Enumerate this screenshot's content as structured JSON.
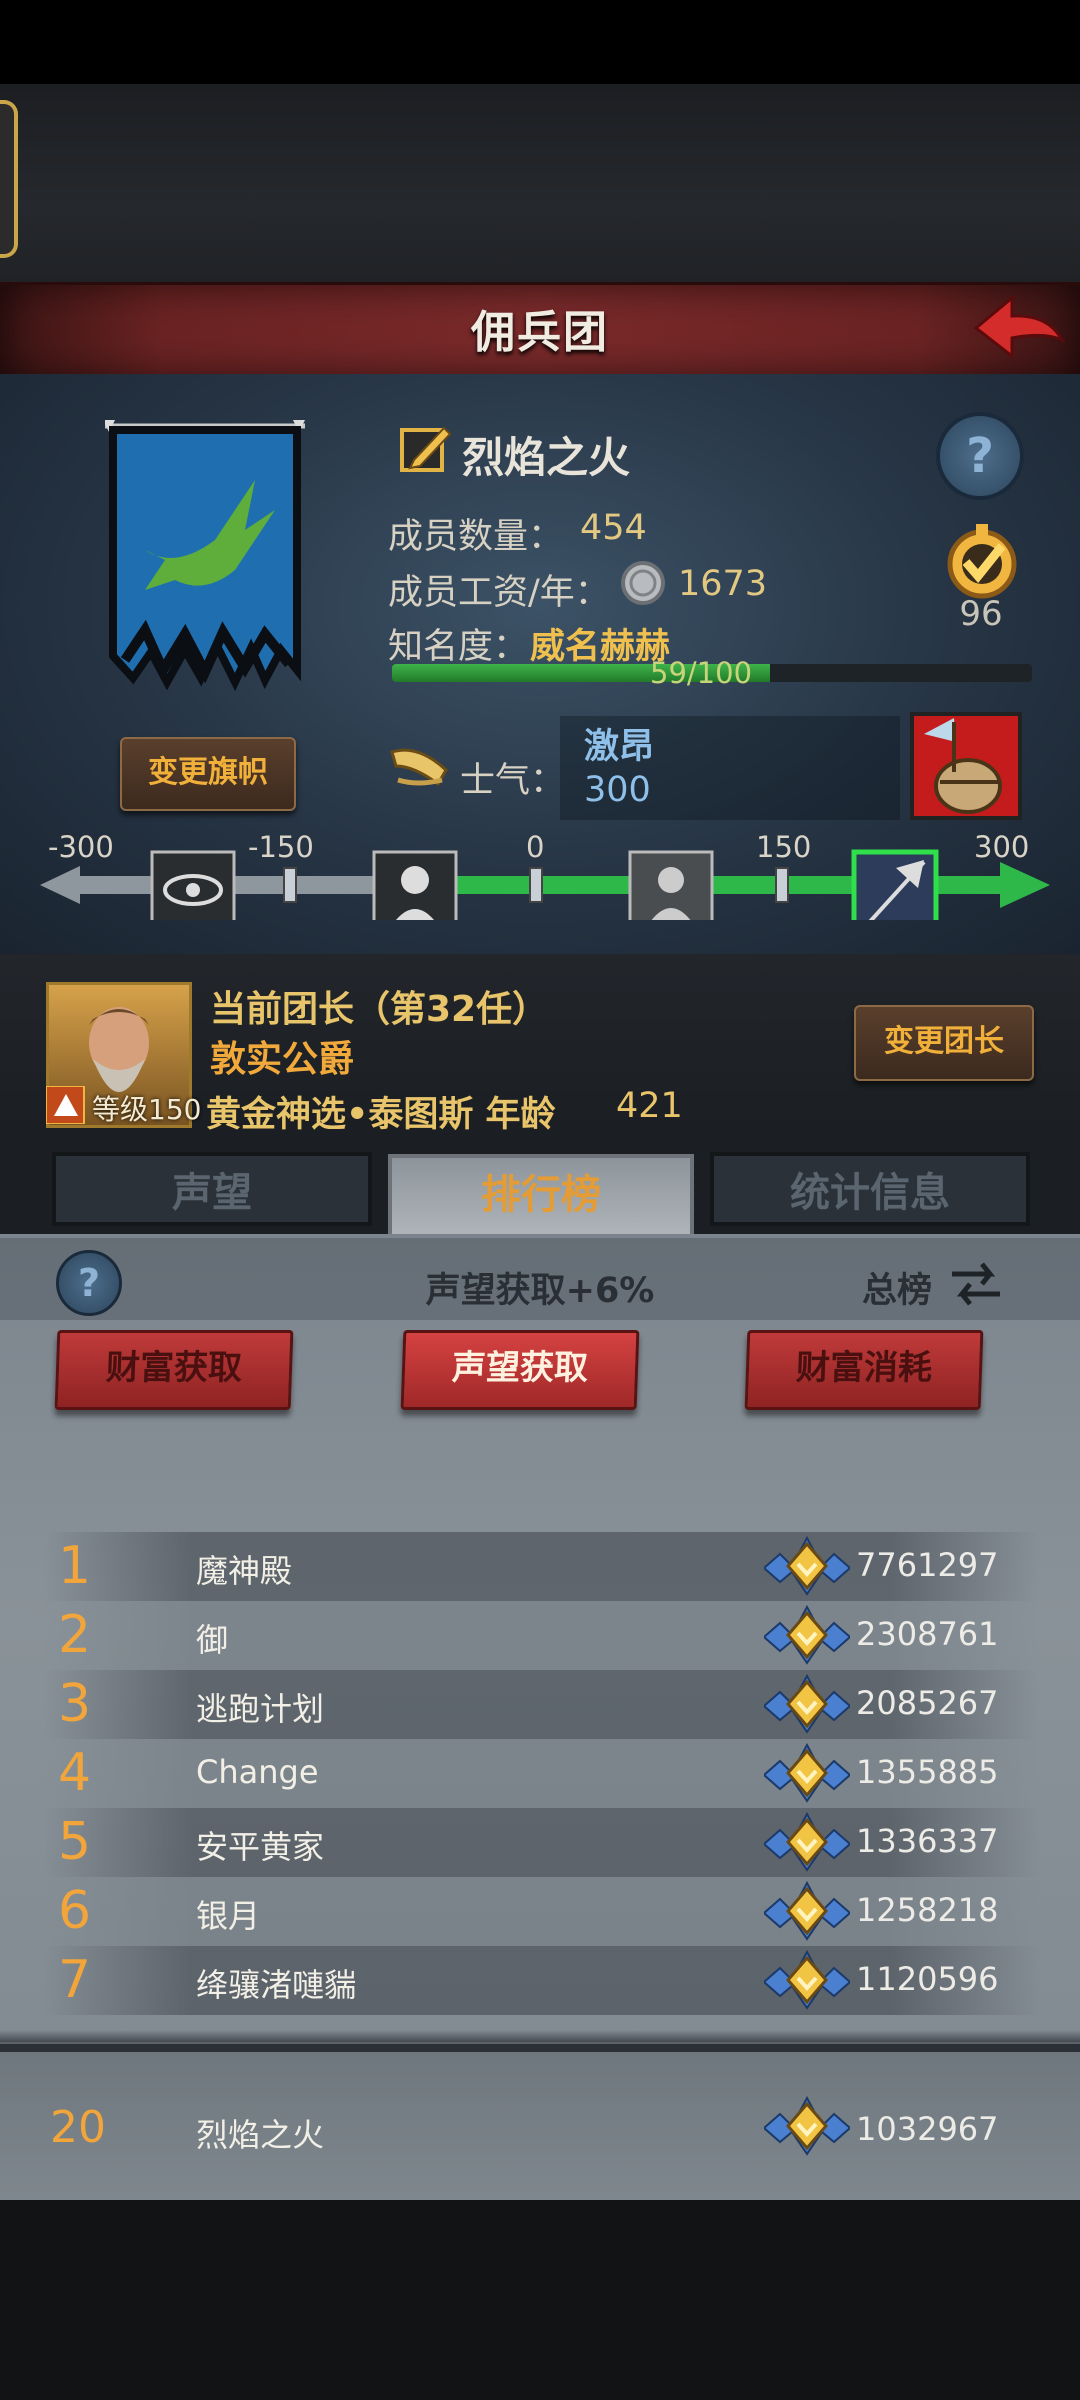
{
  "header": {
    "title": "佣兵团"
  },
  "guild": {
    "name": "烈焰之火",
    "members_label": "成员数量：",
    "members_value": "454",
    "wage_label": "成员工资/年：",
    "wage_value": "1673",
    "fame_label": "知名度：",
    "fame_value": "威名赫赫",
    "fame_progress_text": "59/100",
    "fame_progress_fraction": 0.59,
    "badge_value": "96",
    "change_flag_label": "变更旗帜"
  },
  "morale": {
    "label": "士气：",
    "state": "激昂",
    "value": "300",
    "track": {
      "ticks": [
        "-300",
        "-150",
        "0",
        "150",
        "300"
      ],
      "current": 300
    }
  },
  "leader": {
    "title": "当前团长（第32任）",
    "name": "敦实公爵",
    "detail": "黄金神选•泰图斯 年龄",
    "age": "421",
    "level_label": "等级150",
    "change_leader_label": "变更团长"
  },
  "tabs": [
    {
      "label": "声望",
      "active": false
    },
    {
      "label": "排行榜",
      "active": true
    },
    {
      "label": "统计信息",
      "active": false
    }
  ],
  "ranking": {
    "bonus_text": "声望获取+6%",
    "total_label": "总榜",
    "buttons": [
      {
        "label": "财富获取",
        "active": false
      },
      {
        "label": "声望获取",
        "active": true
      },
      {
        "label": "财富消耗",
        "active": false
      }
    ],
    "rows": [
      {
        "rank": "1",
        "name": "魔神殿",
        "score": "7761297"
      },
      {
        "rank": "2",
        "name": "御",
        "score": "2308761"
      },
      {
        "rank": "3",
        "name": "逃跑计划",
        "score": "2085267"
      },
      {
        "rank": "4",
        "name": "Change",
        "score": "1355885"
      },
      {
        "rank": "5",
        "name": "安平黄家",
        "score": "1336337"
      },
      {
        "rank": "6",
        "name": "银月",
        "score": "1258218"
      },
      {
        "rank": "7",
        "name": "绛骧渚嗹貒",
        "score": "1120596"
      }
    ],
    "my_row": {
      "rank": "20",
      "name": "烈焰之火",
      "score": "1032967"
    }
  },
  "colors": {
    "accent_gold": "#f2a53a",
    "banner_red": "#7a2a2a",
    "morale_green": "#2fb84a",
    "flag_blue": "#1f6fb0"
  },
  "icons": [
    "edit-icon",
    "help-icon",
    "coin-icon",
    "badge-icon",
    "horn-icon",
    "barrel-icon",
    "gem-icon",
    "swap-icon",
    "back-arrow-icon"
  ]
}
